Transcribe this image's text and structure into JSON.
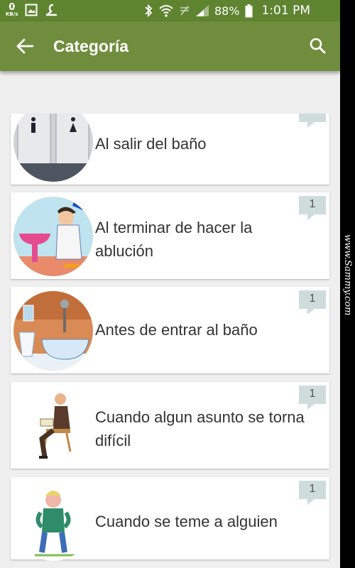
{
  "status_bar": {
    "net_speed": "0",
    "net_unit": "KB/s",
    "battery": "88%",
    "time": "1:01 PM",
    "icons": [
      "image-icon",
      "app-icon",
      "bluetooth-icon",
      "wifi-icon",
      "mute-icon",
      "signal-icon",
      "battery-icon"
    ]
  },
  "app_bar": {
    "title": "Categoría",
    "back_icon": "arrow-left-icon",
    "search_icon": "search-icon"
  },
  "items": [
    {
      "label_line1": "Al salir del baño",
      "label_line2": "",
      "count": ""
    },
    {
      "label_line1": "Al terminar de hacer la",
      "label_line2": "ablución",
      "count": "1"
    },
    {
      "label_line1": "Antes de entrar al baño",
      "label_line2": "",
      "count": "1"
    },
    {
      "label_line1": "Cuando algun asunto se torna",
      "label_line2": "difícil",
      "count": "1"
    },
    {
      "label_line1": "Cuando se teme a alguien",
      "label_line2": "",
      "count": "1"
    }
  ],
  "watermark": "www.Sammy.com",
  "colors": {
    "statusbar": "#5f8430",
    "appbar": "#6f8d3c",
    "background": "#efefef",
    "badge": "#cfdcdc"
  }
}
